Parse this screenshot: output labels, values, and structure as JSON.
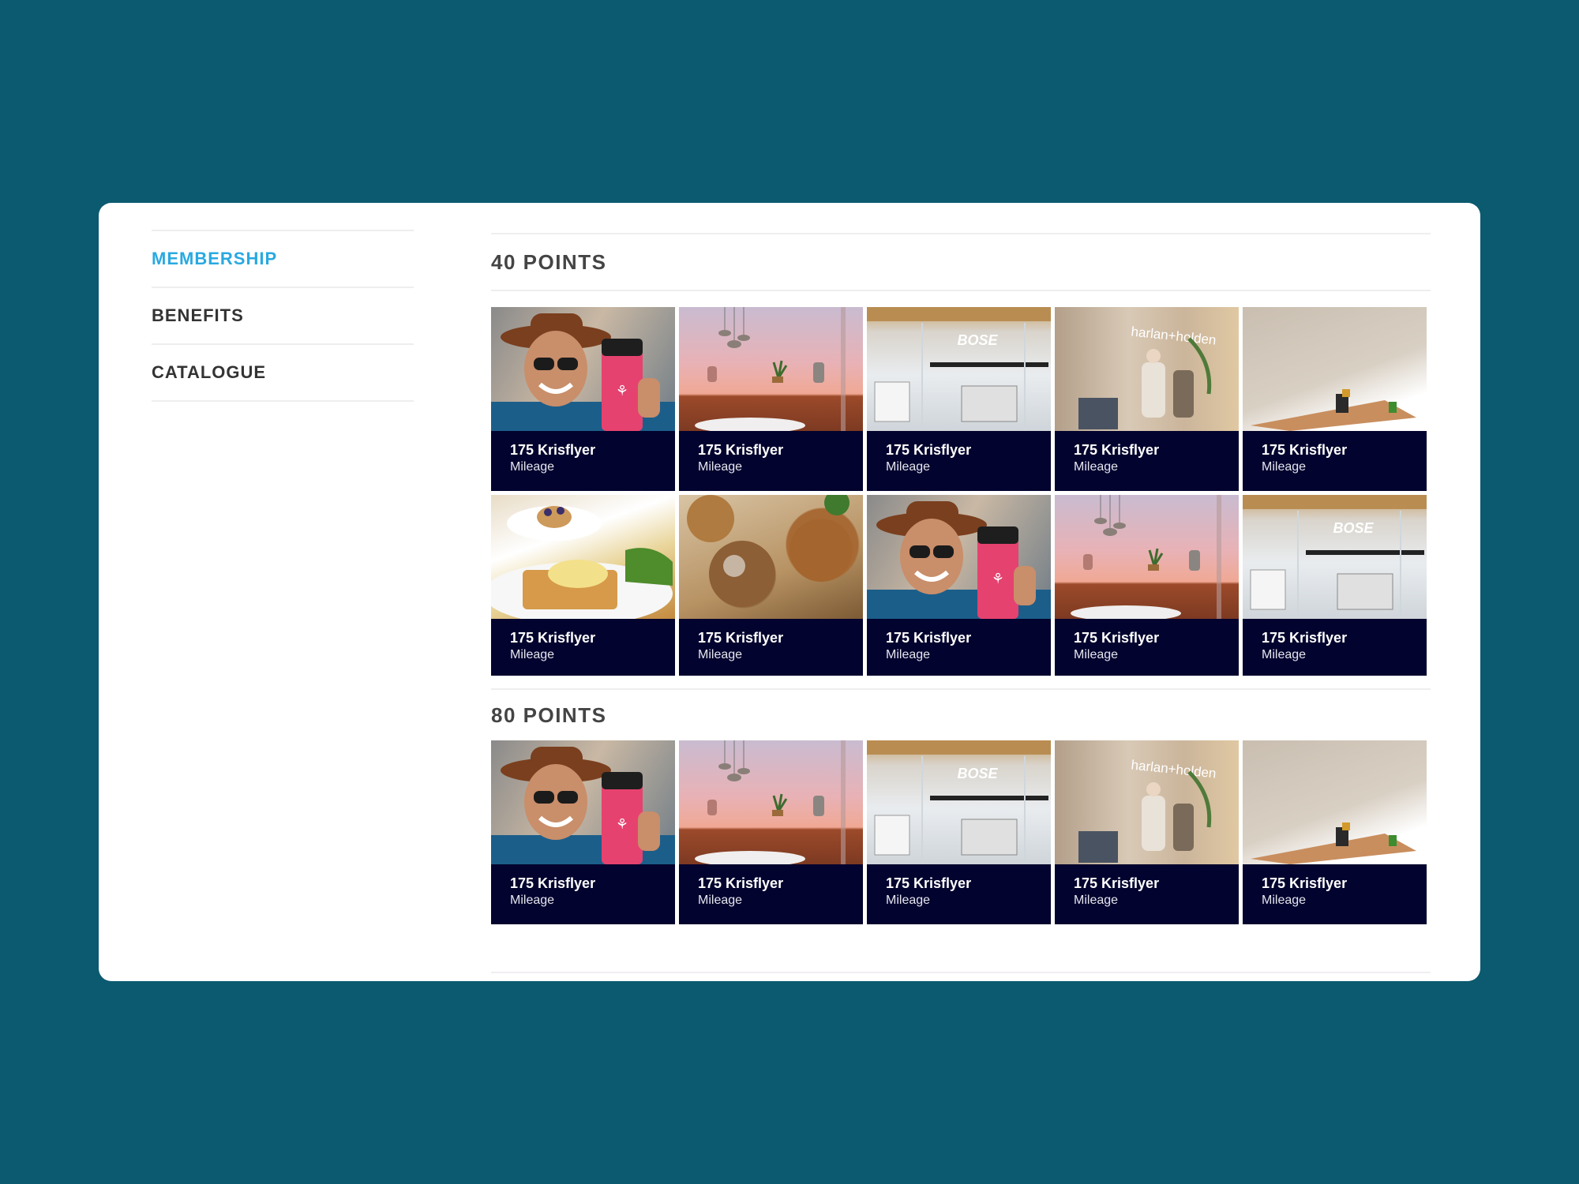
{
  "sidebar": {
    "items": [
      {
        "label": "MEMBERSHIP",
        "active": true
      },
      {
        "label": "BENEFITS",
        "active": false
      },
      {
        "label": "CATALOGUE",
        "active": false
      }
    ]
  },
  "sections": [
    {
      "title": "40 POINTS",
      "tiles": [
        {
          "title": "175 Krisflyer",
          "subtitle": "Mileage",
          "image": "person-with-pink-bottle"
        },
        {
          "title": "175 Krisflyer",
          "subtitle": "Mileage",
          "image": "sunset-lounge"
        },
        {
          "title": "175 Krisflyer",
          "subtitle": "Mileage",
          "image": "bose-store"
        },
        {
          "title": "175 Krisflyer",
          "subtitle": "Mileage",
          "image": "harlan-holden-store"
        },
        {
          "title": "175 Krisflyer",
          "subtitle": "Mileage",
          "image": "desk-objects"
        },
        {
          "title": "175 Krisflyer",
          "subtitle": "Mileage",
          "image": "waffle-plate"
        },
        {
          "title": "175 Krisflyer",
          "subtitle": "Mileage",
          "image": "meatballs"
        },
        {
          "title": "175 Krisflyer",
          "subtitle": "Mileage",
          "image": "person-with-pink-bottle"
        },
        {
          "title": "175 Krisflyer",
          "subtitle": "Mileage",
          "image": "sunset-lounge"
        },
        {
          "title": "175 Krisflyer",
          "subtitle": "Mileage",
          "image": "bose-store"
        }
      ]
    },
    {
      "title": "80 POINTS",
      "tiles": [
        {
          "title": "175 Krisflyer",
          "subtitle": "Mileage",
          "image": "person-with-pink-bottle"
        },
        {
          "title": "175 Krisflyer",
          "subtitle": "Mileage",
          "image": "sunset-lounge"
        },
        {
          "title": "175 Krisflyer",
          "subtitle": "Mileage",
          "image": "bose-store"
        },
        {
          "title": "175 Krisflyer",
          "subtitle": "Mileage",
          "image": "harlan-holden-store"
        },
        {
          "title": "175 Krisflyer",
          "subtitle": "Mileage",
          "image": "desk-objects"
        }
      ]
    }
  ],
  "image_text": {
    "bose": "BOSE",
    "harlan": "harlan+holden"
  },
  "colors": {
    "page_bg": "#0b5a70",
    "active_nav": "#29a9e0",
    "tile_label_bg": "#02032e"
  }
}
